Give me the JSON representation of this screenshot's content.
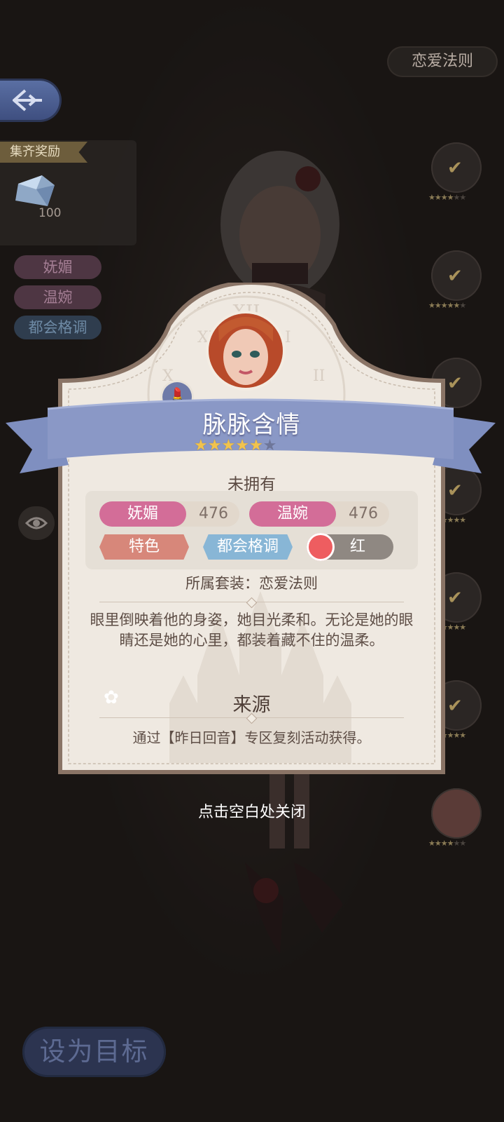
{
  "header": {
    "set_name": "恋爱法则"
  },
  "reward": {
    "tag": "集齐奖励",
    "count": "100"
  },
  "side_tags": [
    "妩媚",
    "温婉",
    "都会格调"
  ],
  "card": {
    "title": "脉脉含情",
    "stars_on": 5,
    "stars_total": 6,
    "status": "未拥有",
    "attr1": {
      "name": "妩媚",
      "value": "476"
    },
    "attr2": {
      "name": "温婉",
      "value": "476"
    },
    "tag_feature": "特色",
    "tag_style": "都会格调",
    "color_name": "红",
    "suit_line": "所属套装：恋爱法则",
    "description": "眼里倒映着他的身姿，她目光柔和。无论是她的眼睛还是她的心里，都装着藏不住的温柔。",
    "source_title": "来源",
    "source_text": "通过【昨日回音】专区复刻活动获得。"
  },
  "close_hint": "点击空白处关闭",
  "target_button": "设为目标",
  "colors": {
    "accent_pink": "#d36d98",
    "accent_blue": "#7f8fc0",
    "dye_red": "#ee5d60"
  }
}
